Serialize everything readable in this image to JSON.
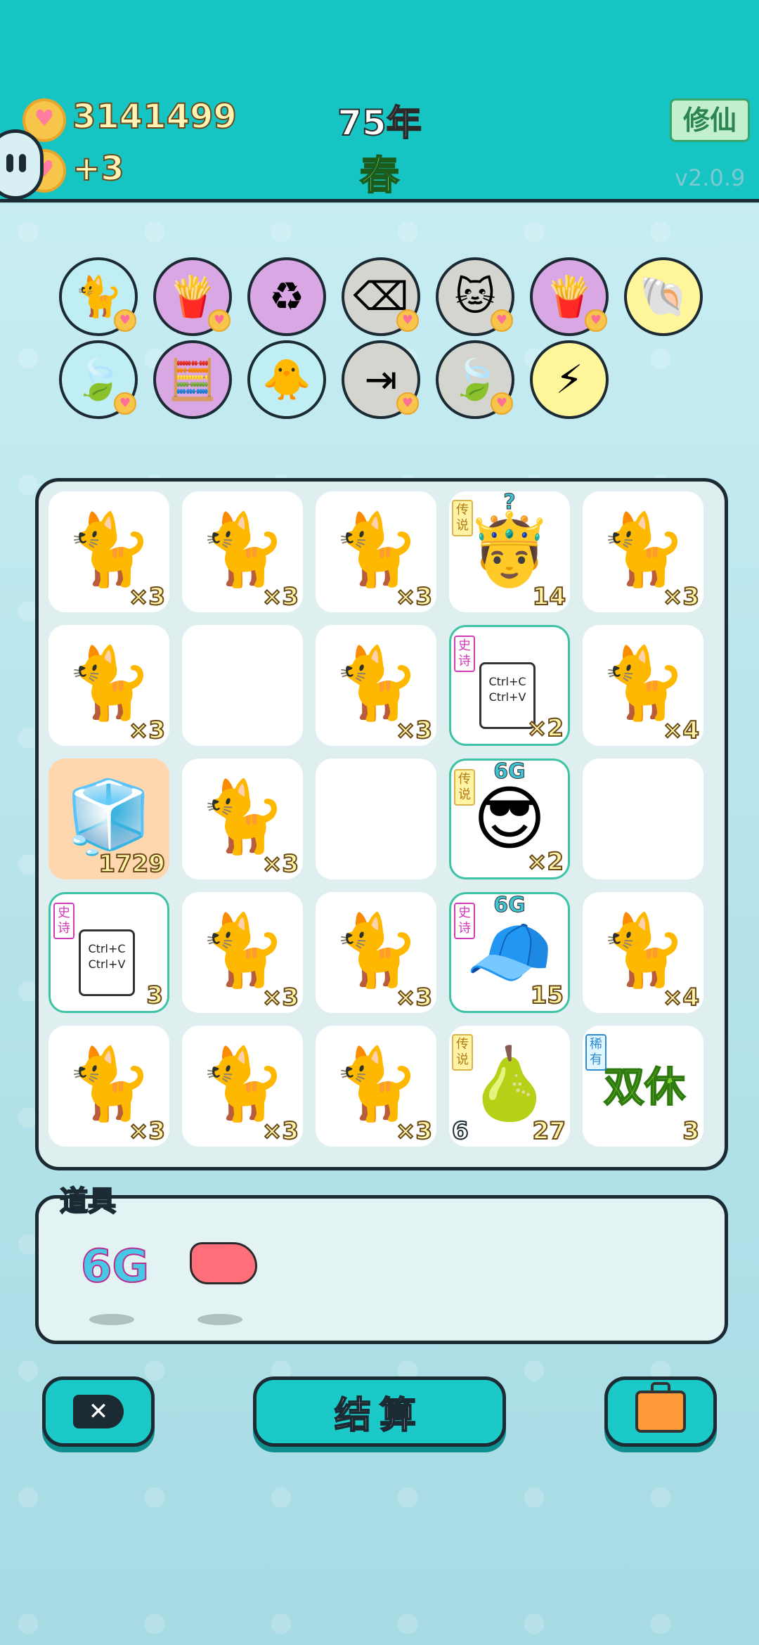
{
  "header": {
    "coins": "3141499",
    "income": "+3",
    "year": "75年",
    "season": "春",
    "mode_button": "修仙",
    "version": "v2.0.9"
  },
  "relics": [
    {
      "name": "cat-with-hole-icon",
      "glyph": "🐈",
      "bg": "#bfeef5",
      "badge": true
    },
    {
      "name": "fries-icon",
      "glyph": "🍟",
      "bg": "#d9a7e3",
      "badge": true
    },
    {
      "name": "recycle-icon",
      "glyph": "♻",
      "bg": "#d9a7e3",
      "badge": false
    },
    {
      "name": "delete-key-icon",
      "glyph": "⌫",
      "bg": "#d5d5d0",
      "badge": true
    },
    {
      "name": "owl-cats-icon",
      "glyph": "🐱",
      "bg": "#d5d5d0",
      "badge": true
    },
    {
      "name": "fries-icon",
      "glyph": "🍟",
      "bg": "#d9a7e3",
      "badge": true
    },
    {
      "name": "seashell-icon",
      "glyph": "🐚",
      "bg": "#fff59a",
      "badge": false
    },
    {
      "name": "leaf-icon",
      "glyph": "🍃",
      "bg": "#bfeef5",
      "badge": true
    },
    {
      "name": "math-head-icon",
      "glyph": "🧮",
      "bg": "#d9a7e3",
      "badge": false
    },
    {
      "name": "chick-egg-icon",
      "glyph": "🐥",
      "bg": "#bfeef5",
      "badge": false
    },
    {
      "name": "skip-icon",
      "glyph": "⇥",
      "bg": "#d5d5d0",
      "badge": true
    },
    {
      "name": "leaf-icon",
      "glyph": "🍃",
      "bg": "#d5d5d0",
      "badge": true
    },
    {
      "name": "lightning-icon",
      "glyph": "⚡",
      "bg": "#fff59a",
      "badge": false
    }
  ],
  "board": [
    [
      {
        "type": "cat",
        "count": "×3"
      },
      {
        "type": "cat",
        "count": "×3"
      },
      {
        "type": "cat",
        "count": "×3"
      },
      {
        "type": "king",
        "count": "14",
        "tag": "传说",
        "tag_class": "legend",
        "above": "?"
      },
      {
        "type": "cat",
        "count": "×3"
      }
    ],
    [
      {
        "type": "cat",
        "count": "×3"
      },
      {
        "type": "empty"
      },
      {
        "type": "cat",
        "count": "×3"
      },
      {
        "type": "ctrl",
        "count": "×2",
        "tag": "史诗",
        "tag_class": "epic",
        "hl": true,
        "ctrl_text": "Ctrl+C Ctrl+V"
      },
      {
        "type": "cat",
        "count": "×4"
      }
    ],
    [
      {
        "type": "fridge",
        "count": "1729",
        "orange": true
      },
      {
        "type": "cat",
        "count": "×3"
      },
      {
        "type": "empty"
      },
      {
        "type": "glasses-man",
        "count": "×2",
        "tag": "传说",
        "tag_class": "legend",
        "above": "6G",
        "hl": true
      },
      {
        "type": "empty"
      }
    ],
    [
      {
        "type": "ctrl",
        "count": "3",
        "tag": "史诗",
        "tag_class": "epic",
        "hl": true,
        "ctrl_text": "Ctrl+C Ctrl+V"
      },
      {
        "type": "cat",
        "count": "×3"
      },
      {
        "type": "cat",
        "count": "×3"
      },
      {
        "type": "red-cap-boy",
        "count": "15",
        "tag": "史诗",
        "tag_class": "epic",
        "above": "6G",
        "hl": true
      },
      {
        "type": "cat",
        "count": "×4"
      }
    ],
    [
      {
        "type": "cat",
        "count": "×3"
      },
      {
        "type": "cat",
        "count": "×3"
      },
      {
        "type": "cat",
        "count": "×3"
      },
      {
        "type": "pear-king",
        "count": "27",
        "left_count": "6",
        "tag": "传说",
        "tag_class": "legend"
      },
      {
        "type": "shuangxiu",
        "count": "3",
        "tag": "稀有",
        "tag_class": "rare",
        "art_text": "双休"
      }
    ]
  ],
  "tools": {
    "title": "道具",
    "items": [
      {
        "label": "6G"
      },
      {
        "label": "liver"
      }
    ]
  },
  "buttons": {
    "settle": "结算",
    "delete_glyph": "✕"
  }
}
